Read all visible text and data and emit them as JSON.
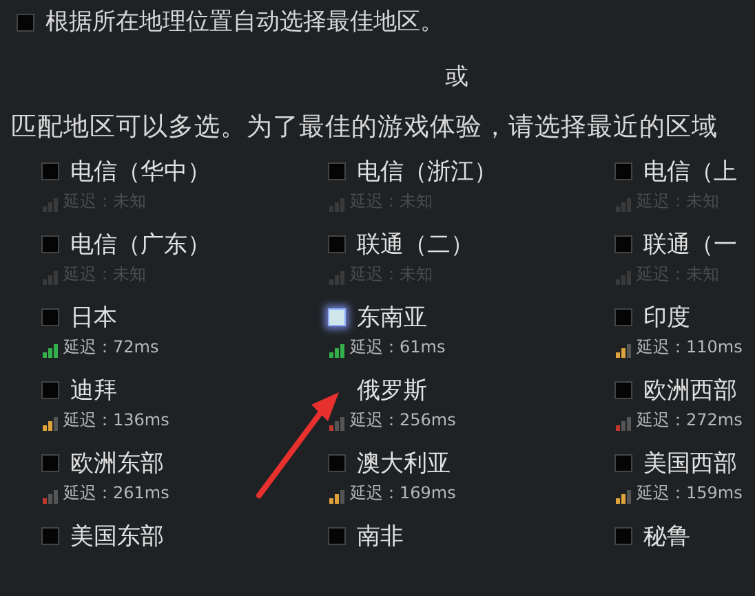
{
  "auto_select": {
    "label": "根据所在地理位置自动选择最佳地区。",
    "checked": false
  },
  "separator": "或",
  "instruction": "匹配地区可以多选。为了最佳的游戏体验，请选择最近的区域",
  "regions": [
    {
      "name": "电信（华中）",
      "checked": false,
      "latency": "延迟：未知",
      "kind": "unknown"
    },
    {
      "name": "电信（浙江）",
      "checked": false,
      "latency": "延迟：未知",
      "kind": "unknown"
    },
    {
      "name": "电信（上",
      "checked": false,
      "latency": "延迟：未知",
      "kind": "unknown"
    },
    {
      "name": "电信（广东）",
      "checked": false,
      "latency": "延迟：未知",
      "kind": "unknown"
    },
    {
      "name": "联通（二）",
      "checked": false,
      "latency": "延迟：未知",
      "kind": "unknown"
    },
    {
      "name": "联通（一",
      "checked": false,
      "latency": "延迟：未知",
      "kind": "unknown"
    },
    {
      "name": "日本",
      "checked": false,
      "latency": "延迟：72ms",
      "kind": "good"
    },
    {
      "name": "东南亚",
      "checked": true,
      "latency": "延迟：61ms",
      "kind": "good"
    },
    {
      "name": "印度",
      "checked": false,
      "latency": "延迟：110ms",
      "kind": "fair"
    },
    {
      "name": "迪拜",
      "checked": false,
      "latency": "延迟：136ms",
      "kind": "fair"
    },
    {
      "name": "俄罗斯",
      "latency": "延迟：256ms",
      "kind": "poor"
    },
    {
      "name": "欧洲西部",
      "checked": false,
      "latency": "延迟：272ms",
      "kind": "poor"
    },
    {
      "name": "欧洲东部",
      "checked": false,
      "latency": "延迟：261ms",
      "kind": "poor"
    },
    {
      "name": "澳大利亚",
      "checked": false,
      "latency": "延迟：169ms",
      "kind": "fair"
    },
    {
      "name": "美国西部",
      "checked": false,
      "latency": "延迟：159ms",
      "kind": "fair"
    },
    {
      "name": "美国东部",
      "checked": false
    },
    {
      "name": "南非",
      "checked": false
    },
    {
      "name": "秘鲁",
      "checked": false
    }
  ]
}
